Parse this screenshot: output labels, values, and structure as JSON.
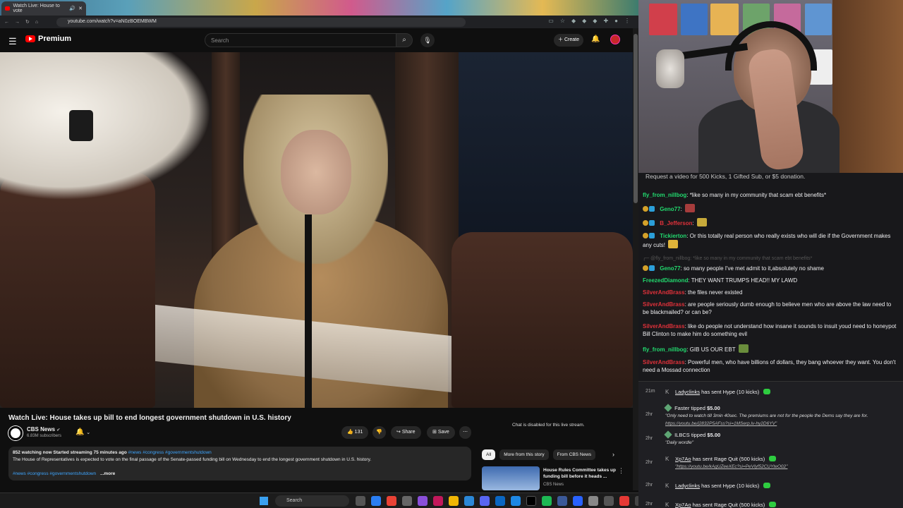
{
  "browser": {
    "tab_title": "Watch Live: House to vote",
    "url": "youtube.com/watch?v=aN0zBOEMBWM"
  },
  "youtube": {
    "logo_text": "Premium",
    "search_placeholder": "Search",
    "create_label": "Create",
    "video_title": "Watch Live: House takes up bill to end longest government shutdown in U.S. history",
    "channel_name": "CBS News",
    "channel_subs": "6.83M subscribers",
    "like_count": "131",
    "share_label": "Share",
    "save_label": "Save",
    "desc_meta": "852 watching now  Started streaming 75 minutes ago",
    "desc_meta_tags": "#news #congress #governmentshutdown",
    "desc_text": "The House of Representatives is expected to vote on the final passage of the Senate-passed funding bill on Wednesday to end the longest government shutdown in U.S. history.",
    "desc_tags": "#news #congress #governmentshutdown",
    "desc_more": "...more",
    "chat_disabled": "Chat is disabled for this live stream.",
    "rec_chips": [
      "All",
      "More from this story",
      "From CBS News"
    ],
    "rec_title": "House Rules Committee takes up funding bill before it heads ...",
    "rec_channel": "CBS News"
  },
  "taskbar": {
    "search_label": "Search"
  },
  "chat": {
    "banner": "Request a video for 500 Kicks, 1 Gifted Sub, or $5 donation.",
    "messages": [
      {
        "user": "fly_from_nillbog",
        "text": "*like so many in my community that scam ebt benefits*"
      },
      {
        "user": "Geno77",
        "text": ""
      },
      {
        "user": "B_Jefferson",
        "text": ""
      },
      {
        "user": "Tickierton",
        "text": "Or this totally real person who really exists who will die if the Government makes any cuts!"
      },
      {
        "reply": "@fly_from_nillbog: *like so many in my community that scam ebt benefits*"
      },
      {
        "user": "Geno77",
        "text": "so many people I've met admit to it,absolutely no shame"
      },
      {
        "user": "FreezedDiamond",
        "text": "THEY WANT TRUMPS HEAD!! MY LAWD"
      },
      {
        "user": "SilverAndBrass",
        "text": "the files never existed"
      },
      {
        "user": "SilverAndBrass",
        "text": "are people seriously dumb enough to believe men who are above the law need to be blackmailed? or can be?"
      },
      {
        "user": "SilverAndBrass",
        "text": "like do people not understand how insane it sounds to insuit youd need to honeypot Bill Clinton to make him do something evil"
      },
      {
        "user": "fly_from_nillbog",
        "text": "GIB US OUR EBT"
      },
      {
        "user": "SilverAndBrass",
        "text": "Powerful men, who have billions of dollars, they bang whoever they want. You don't need a Mossad connection"
      }
    ],
    "events": [
      {
        "time": "21m",
        "name": "Ladyclinks",
        "action": "has sent",
        "item": "Hype (10 kicks)"
      },
      {
        "time": "2hr",
        "name": "Faster",
        "action": "tipped",
        "amount": "$5.00",
        "quote": "\"Only need to watch till 3min 40sec. The premiums are not for the people the Dems say they are for.",
        "link": "https://youtu.be/j2832P5AFss?si=1MSerp.lv-hy2D6YV\""
      },
      {
        "time": "2hr",
        "name": "ILBCS",
        "action": "tipped",
        "amount": "$5.00",
        "quote": "\"Daily wordle\""
      },
      {
        "time": "2hr",
        "name": "Xp7Ao",
        "action": "has sent",
        "item": "Rage Quit (500 kicks)",
        "link": "\"https://youtu.be/kAgUZeeXEc?si=PeVlyf52CUYteO02\""
      },
      {
        "time": "2hr",
        "name": "Ladyclinks",
        "action": "has sent",
        "item": "Hype (10 kicks)"
      },
      {
        "time": "2hr",
        "name": "Xp7Ao",
        "action": "has sent",
        "item": "Rage Quit (500 kicks)"
      }
    ]
  },
  "colors": {
    "youtube_red": "#ff0000",
    "green_user": "#22d96e",
    "red_user": "#e0313a",
    "kick_green": "#2ecc40"
  }
}
